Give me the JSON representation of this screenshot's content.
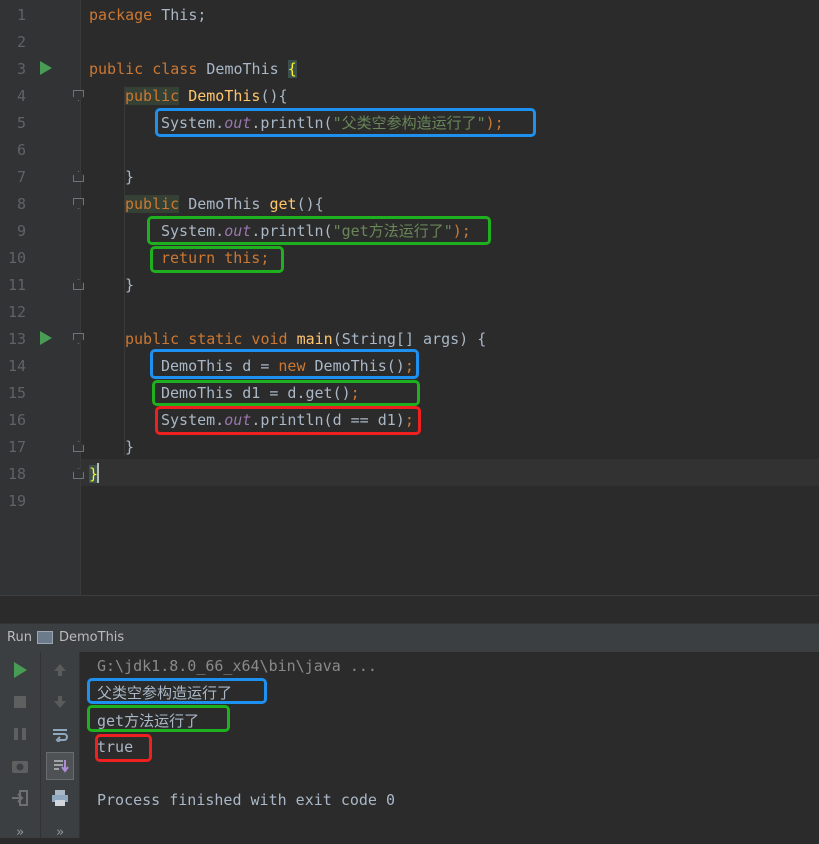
{
  "editor": {
    "line_numbers": [
      "1",
      "2",
      "3",
      "4",
      "5",
      "6",
      "7",
      "8",
      "9",
      "10",
      "11",
      "12",
      "13",
      "14",
      "15",
      "16",
      "17",
      "18",
      "19"
    ],
    "lines": {
      "l1": {
        "kw": "package",
        "rest": " This;"
      },
      "l3": {
        "kw": "public class",
        "name": "DemoThis",
        "brace": "{"
      },
      "l4": {
        "kw": "public",
        "ctor": "DemoThis",
        "rest": "(){"
      },
      "l5": {
        "a": "System.",
        "out": "out",
        "b": ".println(",
        "str": "\"父类空参构造运行了\"",
        "c": ");"
      },
      "l7": {
        "text": "}"
      },
      "l8": {
        "kw": "public",
        "type": " DemoThis ",
        "fn": "get",
        "rest": "(){"
      },
      "l9": {
        "a": "System.",
        "out": "out",
        "b": ".println(",
        "str": "\"get方法运行了\"",
        "c": ");"
      },
      "l10": {
        "kw": "return this",
        "c": ";"
      },
      "l11": {
        "text": "}"
      },
      "l13": {
        "kw": "public static void",
        "fn": "main",
        "rest": "(String[] args) {"
      },
      "l14": {
        "a": "DemoThis d = ",
        "kw": "new",
        "b": " DemoThis()",
        "c": ";"
      },
      "l15": {
        "a": "DemoThis d1 = d.get()",
        "c": ";"
      },
      "l16": {
        "a": "System.",
        "out": "out",
        "b": ".println(d == d1)",
        "c": ";"
      },
      "l17": {
        "text": "}"
      },
      "l18": {
        "text": "}"
      }
    }
  },
  "run_panel": {
    "tab_label": "Run",
    "config_name": "DemoThis",
    "console": {
      "command": "G:\\jdk1.8.0_66_x64\\bin\\java ...",
      "out1": "父类空参构造运行了",
      "out2": "get方法运行了",
      "out3": "true",
      "finished": "Process finished with exit code 0"
    },
    "more_label": "»"
  },
  "colors": {
    "blue_box": "#1e90f0",
    "green_box": "#1fb01f",
    "red_box": "#ee2020",
    "run_green": "#499c54"
  },
  "icons": [
    "run-icon",
    "stop-icon",
    "pause-icon",
    "camera-icon",
    "exit-icon",
    "up-arrow-icon",
    "down-arrow-icon",
    "soft-wrap-icon",
    "scroll-to-end-icon",
    "print-icon",
    "run-config-icon"
  ]
}
